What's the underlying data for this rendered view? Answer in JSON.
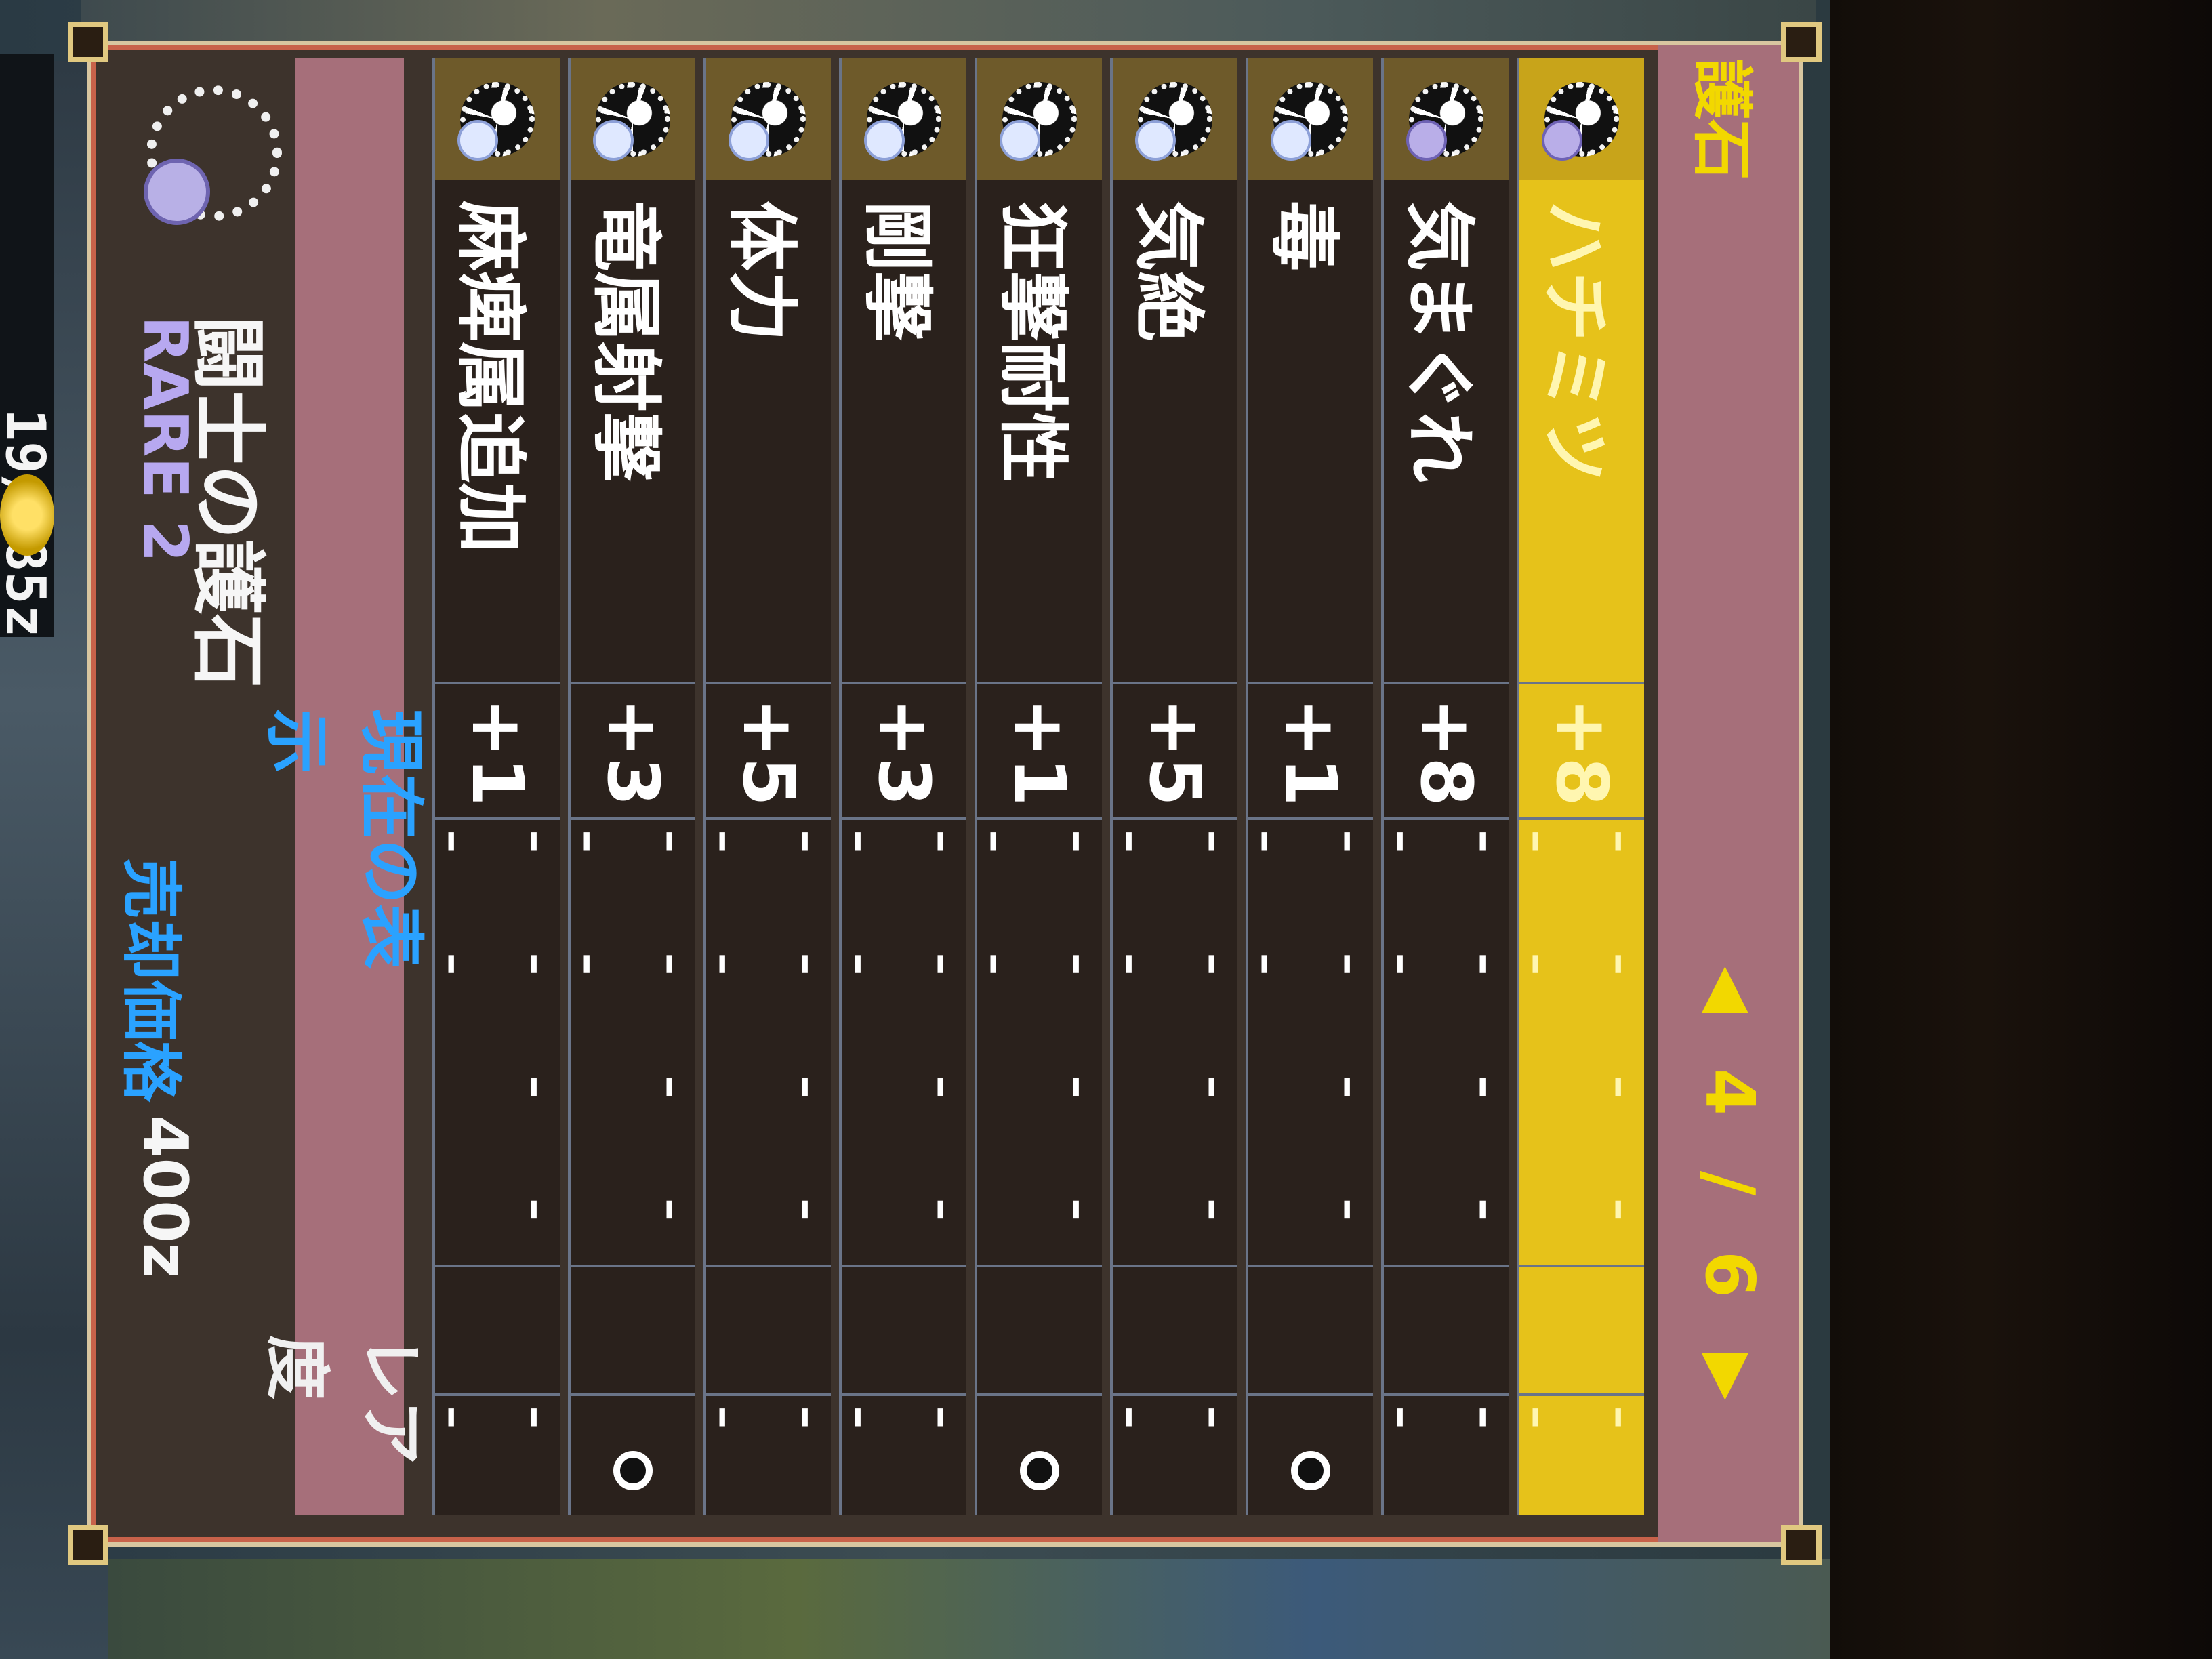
{
  "status": {
    "counter": "19/285z"
  },
  "window": {
    "title": "護石",
    "pager": {
      "prev_icon": "chevron-left-icon",
      "next_icon": "chevron-right-icon",
      "current": "4",
      "separator": "/",
      "total": "6"
    }
  },
  "rows": [
    {
      "name": "ハチミツ",
      "value": "+8",
      "dash": "- - - - - -",
      "dash3": "- -",
      "slot": false,
      "selected": true
    },
    {
      "name": "気まぐれ",
      "value": "+8",
      "dash": "- - - - - -",
      "dash3": "- -",
      "slot": false,
      "selected": false
    },
    {
      "name": "毒",
      "value": "+1",
      "dash": "- - - - - -",
      "dash3": "",
      "slot": true,
      "selected": false
    },
    {
      "name": "気絶",
      "value": "+5",
      "dash": "- - - - - -",
      "dash3": "- -",
      "slot": false,
      "selected": false
    },
    {
      "name": "狂撃耐性",
      "value": "+1",
      "dash": "- - - - - -",
      "dash3": "",
      "slot": true,
      "selected": false
    },
    {
      "name": "剛撃",
      "value": "+3",
      "dash": "- - - - - -",
      "dash3": "- -",
      "slot": false,
      "selected": false
    },
    {
      "name": "体力",
      "value": "+5",
      "dash": "- - - - - -",
      "dash3": "- -",
      "slot": false,
      "selected": false
    },
    {
      "name": "竜属射撃",
      "value": "+3",
      "dash": "- - - - - -",
      "dash3": "",
      "slot": true,
      "selected": false
    },
    {
      "name": "麻痺属追加",
      "value": "+1",
      "dash": "- - - - - -",
      "dash3": "- -",
      "slot": false,
      "selected": false
    }
  ],
  "footer": {
    "filter": "現在の表示",
    "rarity_sort": "レア度"
  },
  "detail": {
    "name": "闘士の護石",
    "rare": "RARE 2",
    "price_label": "売却価格",
    "price": "400z"
  }
}
